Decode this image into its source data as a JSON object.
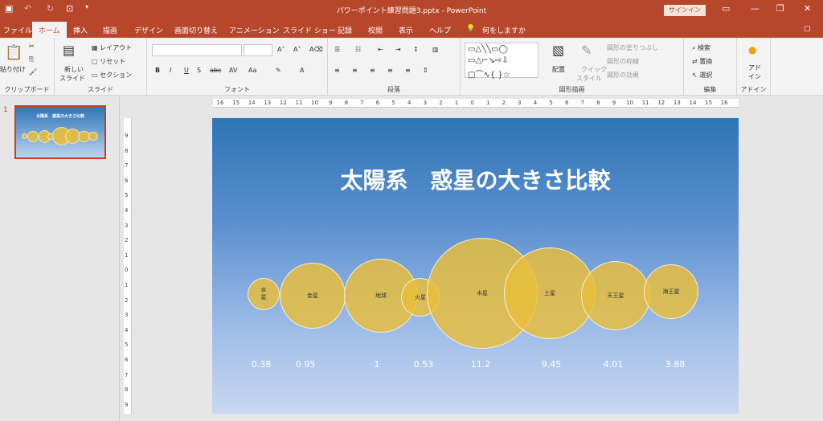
{
  "app": {
    "doc_title": "パワーポイント練習問題3.pptx  -  PowerPoint",
    "signin": "サインイン"
  },
  "tabs": [
    "ファイル",
    "ホーム",
    "挿入",
    "描画",
    "デザイン",
    "画面切り替え",
    "アニメーション",
    "スライド ショー",
    "記録",
    "校閲",
    "表示",
    "ヘルプ"
  ],
  "search": "何をしますか",
  "ribbon": {
    "clipboard": {
      "paste": "貼り付け",
      "label": "クリップボード"
    },
    "slides": {
      "new_slide": "新しい",
      "new_slide2": "スライド",
      "layout": "レイアウト",
      "reset": "リセット",
      "section": "セクション",
      "label": "スライド"
    },
    "font": {
      "label": "フォント"
    },
    "paragraph": {
      "label": "段落"
    },
    "drawing": {
      "arrange": "配置",
      "quick": "クイック",
      "quick2": "スタイル",
      "fill": "図形の塗りつぶし",
      "outline": "図形の枠線",
      "effect": "図形の効果",
      "label": "図形描画"
    },
    "editing": {
      "find": "検索",
      "replace": "置換",
      "select": "選択",
      "label": "編集"
    },
    "addins": {
      "label1": "アド",
      "label2": "イン",
      "label": "アドイン"
    }
  },
  "thumbnail": {
    "number": "1"
  },
  "slide": {
    "title": "太陽系　惑星の大きさ比較",
    "planets": [
      {
        "name": "水星",
        "value": "0.38"
      },
      {
        "name": "金星",
        "value": "0.95"
      },
      {
        "name": "地球",
        "value": "1"
      },
      {
        "name": "火星",
        "value": "0.53"
      },
      {
        "name": "木星",
        "value": "11.2"
      },
      {
        "name": "土星",
        "value": "9.45"
      },
      {
        "name": "天王星",
        "value": "4.01"
      },
      {
        "name": "海王星",
        "value": "3.88"
      }
    ]
  },
  "ruler": {
    "h": [
      "16",
      "15",
      "14",
      "13",
      "12",
      "11",
      "10",
      "9",
      "8",
      "7",
      "6",
      "5",
      "4",
      "3",
      "2",
      "1",
      "0",
      "1",
      "2",
      "3",
      "4",
      "5",
      "6",
      "7",
      "8",
      "9",
      "10",
      "11",
      "12",
      "13",
      "14",
      "15",
      "16"
    ],
    "v": [
      "9",
      "8",
      "7",
      "6",
      "5",
      "4",
      "3",
      "2",
      "1",
      "0",
      "1",
      "2",
      "3",
      "4",
      "5",
      "6",
      "7",
      "8",
      "9"
    ]
  }
}
